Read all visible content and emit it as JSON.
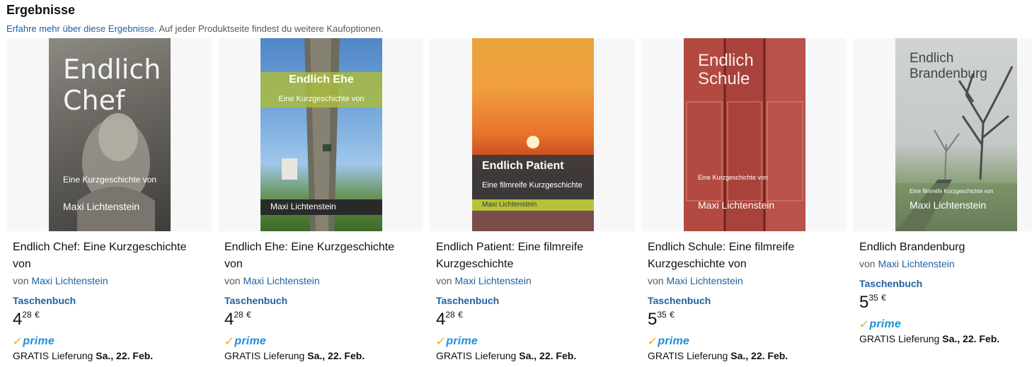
{
  "header": {
    "title": "Ergebnisse",
    "learn_more": "Erfahre mehr über diese Ergebnisse.",
    "note": " Auf jeder Produktseite findest du weitere Kaufoptionen."
  },
  "colors": {
    "link": "#2162a1",
    "prime_check": "#f8a100",
    "prime_text": "#1e90d6"
  },
  "products": [
    {
      "title": "Endlich Chef: Eine Kurzgeschichte von",
      "by": "von ",
      "author": "Maxi Lichtenstein",
      "format": "Taschenbuch",
      "price_whole": "4",
      "price_fraction": "28",
      "currency": "€",
      "prime": "prime",
      "delivery_prefix": "GRATIS Lieferung ",
      "delivery_date": "Sa., 22. Feb.",
      "cover": {
        "line1": "Endlich",
        "line2": "Chef",
        "subtitle": "Eine Kurzgeschichte von",
        "author": "Maxi Lichtenstein"
      }
    },
    {
      "title": "Endlich Ehe: Eine Kurzgeschichte von",
      "by": "von ",
      "author": "Maxi Lichtenstein",
      "format": "Taschenbuch",
      "price_whole": "4",
      "price_fraction": "28",
      "currency": "€",
      "prime": "prime",
      "delivery_prefix": "GRATIS Lieferung ",
      "delivery_date": "Sa., 22. Feb.",
      "cover": {
        "line1": "Endlich Ehe",
        "subtitle": "Eine Kurzgeschichte von",
        "author": "Maxi Lichtenstein"
      }
    },
    {
      "title": "Endlich Patient: Eine filmreife Kurzgeschichte",
      "by": "von ",
      "author": "Maxi Lichtenstein",
      "format": "Taschenbuch",
      "price_whole": "4",
      "price_fraction": "28",
      "currency": "€",
      "prime": "prime",
      "delivery_prefix": "GRATIS Lieferung ",
      "delivery_date": "Sa., 22. Feb.",
      "cover": {
        "line1": "Endlich Patient",
        "subtitle": "Eine filmreife Kurzgeschichte",
        "author": "Maxi Lichtenstein"
      }
    },
    {
      "title": "Endlich Schule: Eine filmreife Kurzgeschichte von",
      "by": "von ",
      "author": "Maxi Lichtenstein",
      "format": "Taschenbuch",
      "price_whole": "5",
      "price_fraction": "35",
      "currency": "€",
      "prime": "prime",
      "delivery_prefix": "GRATIS Lieferung ",
      "delivery_date": "Sa., 22. Feb.",
      "cover": {
        "line1": "Endlich",
        "line2": "Schule",
        "subtitle": "Eine Kurzgeschichte von",
        "author": "Maxi Lichtenstein"
      }
    },
    {
      "title": "Endlich Brandenburg",
      "by": "von ",
      "author": "Maxi Lichtenstein",
      "format": "Taschenbuch",
      "price_whole": "5",
      "price_fraction": "35",
      "currency": "€",
      "prime": "prime",
      "delivery_prefix": "GRATIS Lieferung ",
      "delivery_date": "Sa., 22. Feb.",
      "cover": {
        "line1": "Endlich",
        "line2": "Brandenburg",
        "subtitle": "Eine filmreife Kurzgeschichte von",
        "author": "Maxi Lichtenstein"
      }
    }
  ]
}
